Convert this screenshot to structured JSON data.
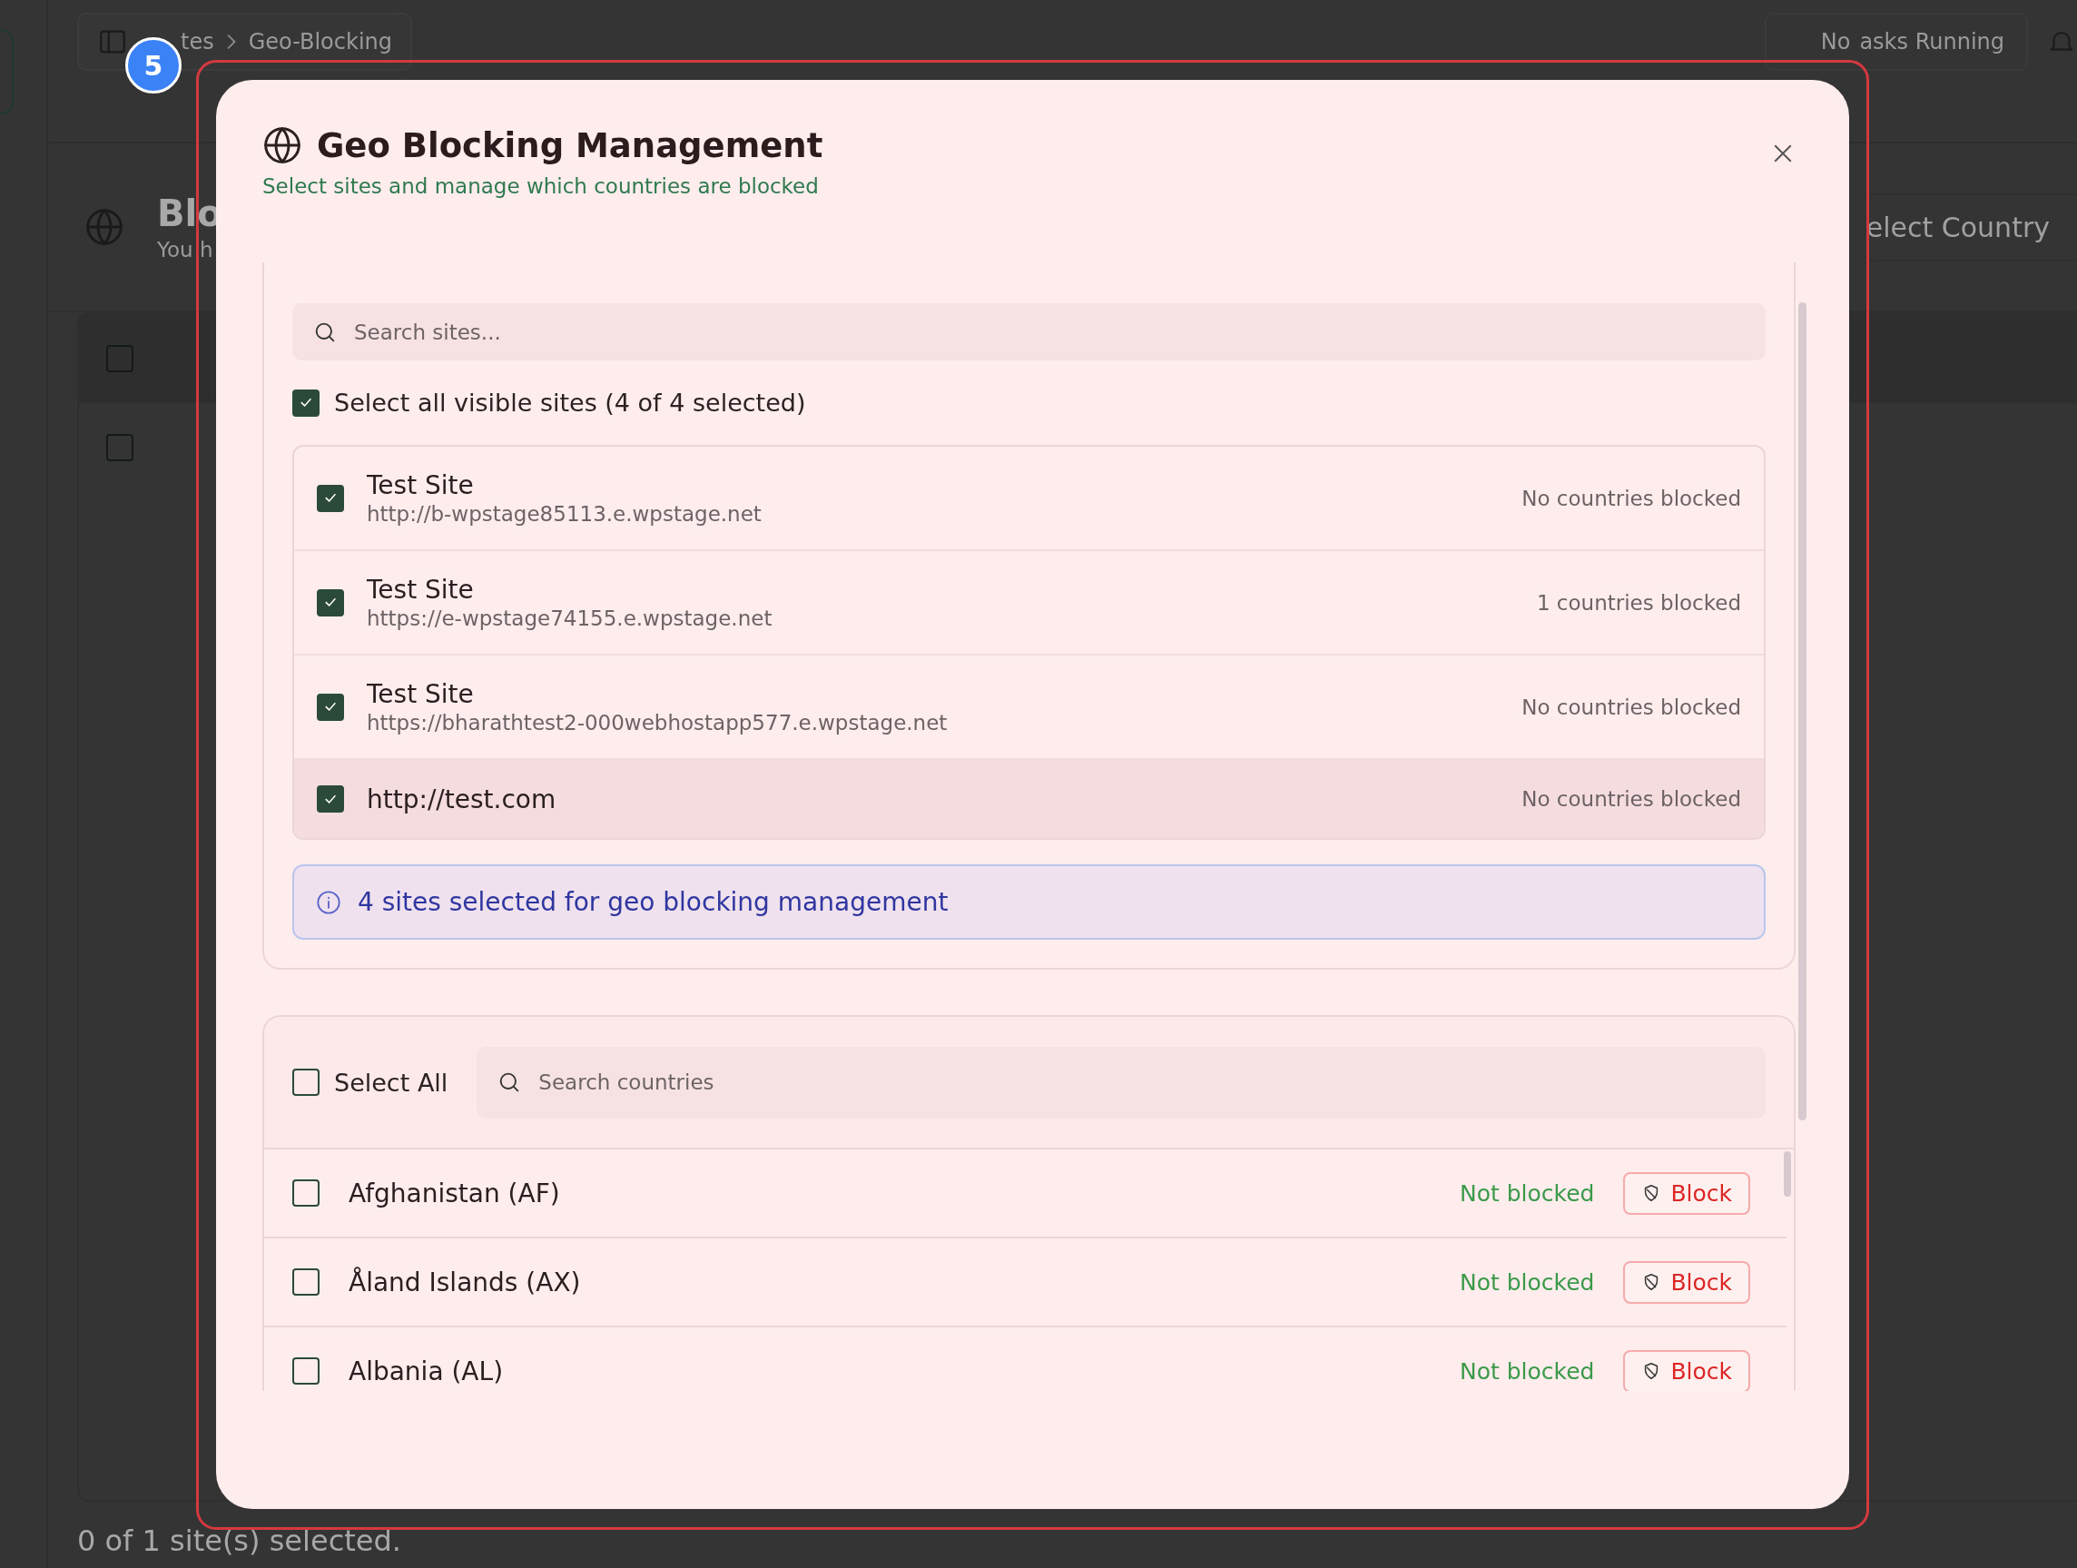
{
  "background": {
    "breadcrumb": [
      {
        "label": "tes"
      },
      {
        "label": "Geo-Blocking"
      }
    ],
    "tasks": [
      "No",
      "asks Running"
    ],
    "page_title": "Blo",
    "page_subtitle": "You h",
    "country_select": "elect Country",
    "table_checkboxes": [
      {
        "checked": false
      },
      {
        "checked": false
      }
    ],
    "footer": "0 of 1 site(s) selected."
  },
  "step_badge": "5",
  "dialog": {
    "title": "Geo Blocking Management",
    "subtitle": "Select sites and manage which countries are blocked",
    "site_search": {
      "placeholder": "Search sites..."
    },
    "select_all_sites": {
      "label": "Select all visible sites (4 of 4 selected)",
      "checked": true
    },
    "sites": [
      {
        "name": "Test Site",
        "url": "http://b-wpstage85113.e.wpstage.net",
        "status": "No countries blocked",
        "checked": true,
        "hovered": false
      },
      {
        "name": "Test Site",
        "url": "https://e-wpstage74155.e.wpstage.net",
        "status": "1 countries blocked",
        "checked": true,
        "hovered": false
      },
      {
        "name": "Test Site",
        "url": "https://bharathtest2-000webhostapp577.e.wpstage.net",
        "status": "No countries blocked",
        "checked": true,
        "hovered": false
      },
      {
        "name": "http://test.com",
        "status": "No countries blocked",
        "checked": true,
        "hovered": true
      }
    ],
    "info": "4 sites selected for geo blocking management",
    "select_all_countries": {
      "label": "Select All",
      "checked": false
    },
    "country_search": {
      "placeholder": "Search countries"
    },
    "countries": [
      {
        "name": "Afghanistan (AF)",
        "status": "Not blocked",
        "checked": false,
        "action": "Block"
      },
      {
        "name": "Åland Islands (AX)",
        "status": "Not blocked",
        "checked": false,
        "action": "Block"
      },
      {
        "name": "Albania (AL)",
        "status": "Not blocked",
        "checked": false,
        "action": "Block"
      }
    ]
  }
}
